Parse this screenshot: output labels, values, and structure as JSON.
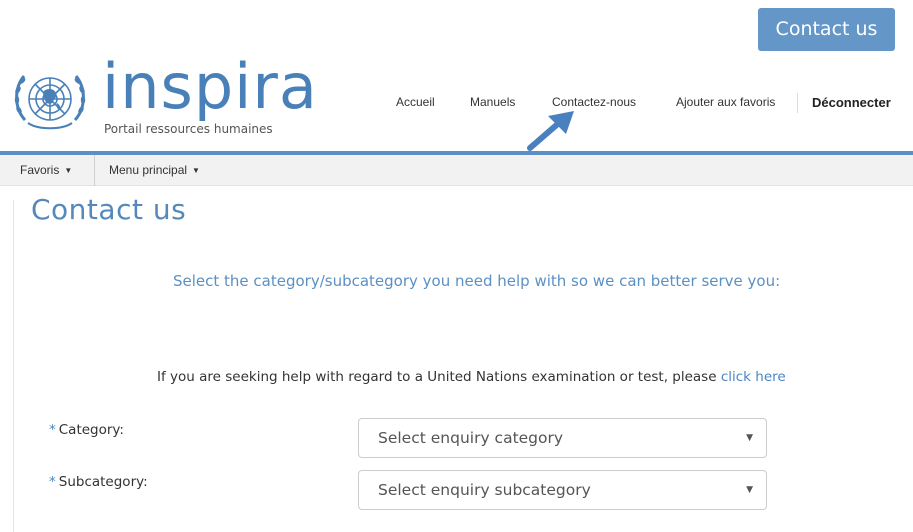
{
  "header": {
    "contact_button": "Contact us",
    "logo_word": "inspira",
    "logo_tagline": "Portail ressources humaines"
  },
  "topnav": {
    "items": [
      "Accueil",
      "Manuels",
      "Contactez-nous",
      "Ajouter aux favoris",
      "Déconnecter"
    ]
  },
  "menubar": {
    "favorites": "Favoris",
    "main_menu": "Menu principal"
  },
  "main": {
    "title": "Contact us",
    "intro": "Select the category/subcategory you need help with so we can better serve you:",
    "exam_text": "If you are seeking help with regard to a United Nations examination or test, please",
    "exam_link": "click here",
    "required_mark": "*",
    "category_label": "Category:",
    "category_placeholder": "Select enquiry category",
    "subcategory_label": "Subcategory:",
    "subcategory_placeholder": "Select enquiry subcategory"
  },
  "colors": {
    "accent": "#5b8fc6",
    "button": "#6496c8",
    "link": "#4a86c4"
  },
  "icons": {
    "emblem": "un-emblem-icon",
    "arrow": "pointer-arrow-icon",
    "dropdown": "dropdown-triangle-icon"
  }
}
